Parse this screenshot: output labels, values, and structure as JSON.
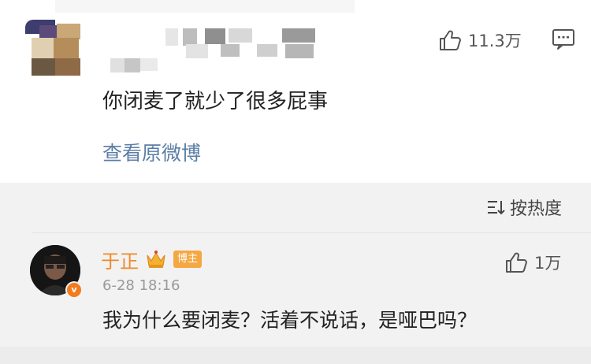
{
  "post": {
    "like_count": "11.3万",
    "text": "你闭麦了就少了很多屁事",
    "view_original": "查看原微博"
  },
  "sort": {
    "label": "按热度"
  },
  "reply": {
    "author": "于正",
    "badge": "博主",
    "verified_mark": "v",
    "timestamp": "6-28 18:16",
    "like_count": "1万",
    "text": "我为什么要闭麦？活着不说话，是哑巴吗？"
  },
  "colors": {
    "author": "#ef8a29",
    "link": "#5b7ea6",
    "badge": "#f5a742",
    "verified": "#f37b1d"
  },
  "icons": [
    "thumbs-up-icon",
    "comment-icon",
    "sort-icon",
    "crown-icon",
    "verified-icon"
  ]
}
